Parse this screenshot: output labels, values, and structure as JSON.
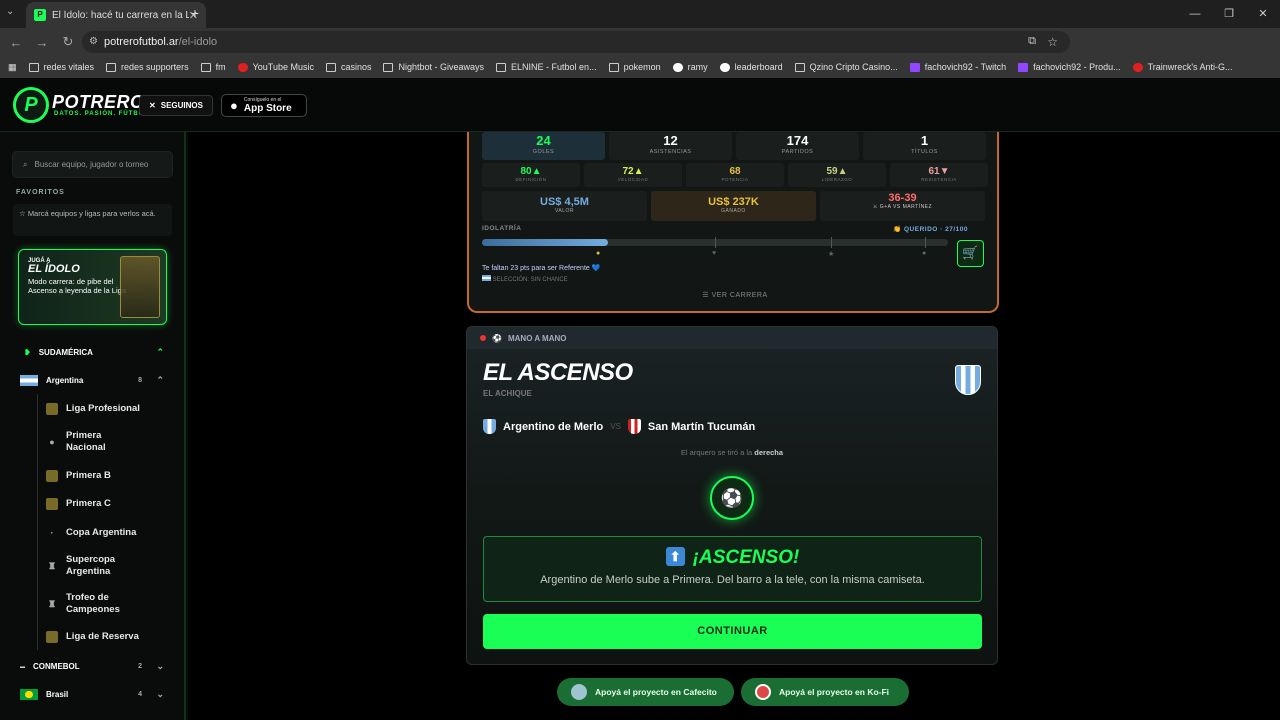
{
  "browser": {
    "tab_title": "El Ídolo: hacé tu carrera en la Li",
    "url_host": "potrerofutbol.ar",
    "url_path": "/el-idolo",
    "bookmarks": [
      "redes vitales",
      "redes supporters",
      "fm",
      "YouTube Music",
      "casinos",
      "Nightbot - Giveaways",
      "ELNINE - Futbol en...",
      "pokemon",
      "ramy",
      "leaderboard",
      "Qzino Cripto Casino...",
      "fachovich92 - Twitch",
      "fachovich92 - Produ...",
      "Trainwreck's Anti-G..."
    ]
  },
  "header": {
    "logo_letter": "P",
    "logo_text": "POTRERO",
    "logo_sub": "DATOS. PASIÓN. FÚTBOL.",
    "follow": "SEGUINOS",
    "appstore_line1": "Consíguelo en el",
    "appstore_line2": "App Store"
  },
  "sidebar": {
    "search_placeholder": "Buscar equipo, jugador o torneo",
    "favorites_title": "FAVORITOS",
    "favorites_empty": "Marcá equipos y ligas para verlos acá.",
    "promo": {
      "line1": "JUGÁ A",
      "line2": "EL ÍDOLO",
      "line3": "Modo carrera: de pibe del Ascenso a leyenda de la Liga"
    },
    "region": "SUDAMÉRICA",
    "country": "Argentina",
    "country_count": "8",
    "leagues": [
      "Liga Profesional",
      "Primera Nacional",
      "Primera B",
      "Primera C",
      "Copa Argentina",
      "Supercopa Argentina",
      "Trofeo de Campeones",
      "Liga de Reserva"
    ],
    "conmebol": "CONMEBOL",
    "conmebol_count": "2",
    "brasil": "Brasil",
    "brasil_count": "4"
  },
  "career": {
    "stats": [
      {
        "value": "24",
        "label": "GOLES"
      },
      {
        "value": "12",
        "label": "ASISTENCIAS"
      },
      {
        "value": "174",
        "label": "PARTIDOS"
      },
      {
        "value": "1",
        "label": "TÍTULOS"
      }
    ],
    "attributes": [
      {
        "value": "80▲",
        "label": "DEFINICIÓN",
        "color": "#1aff55"
      },
      {
        "value": "72▲",
        "label": "VELOCIDAD",
        "color": "#d6f05a"
      },
      {
        "value": "68",
        "label": "POTENCIA",
        "color": "#e8c040"
      },
      {
        "value": "59▲",
        "label": "LIDERAZGO",
        "color": "#c8d080"
      },
      {
        "value": "61▼",
        "label": "RESISTENCIA",
        "color": "#e8a0a0"
      }
    ],
    "value": {
      "value": "US$ 4,5M",
      "label": "VALOR",
      "color": "#74acdf"
    },
    "earned": {
      "value": "US$ 237K",
      "label": "GANADO",
      "color": "#e8c040"
    },
    "vs_record": {
      "value": "36-39",
      "label": "⚔ G+A VS MARTÍNEZ",
      "color": "#ff6b6b"
    },
    "idolatria_label": "IDOLATRÍA",
    "idolatria_status": "👏 QUERIDO · 27/100",
    "idolatria_level": 0.27,
    "faltan": "Te faltan 23 pts para ser Referente 💙",
    "seleccion": "SELECCIÓN: SIN CHANCE",
    "ver_carrera": "☰  VER CARRERA"
  },
  "match": {
    "header": "MANO A MANO",
    "title": "EL ASCENSO",
    "subtitle": "EL ACHIQUE",
    "home": "Argentino de Merlo",
    "vs": "VS",
    "away": "San Martín Tucumán",
    "arquero_prefix": "El arquero se tiró a la",
    "arquero_side": "derecha",
    "result_title": "¡ASCENSO!",
    "result_text": "Argentino de Merlo sube a Primera. Del barro a la tele, con la misma camiseta.",
    "continue": "CONTINUAR"
  },
  "support": {
    "cafecito": "Apoyá el proyecto en Cafecito",
    "kofi": "Apoyá el proyecto en Ko-Fi"
  }
}
